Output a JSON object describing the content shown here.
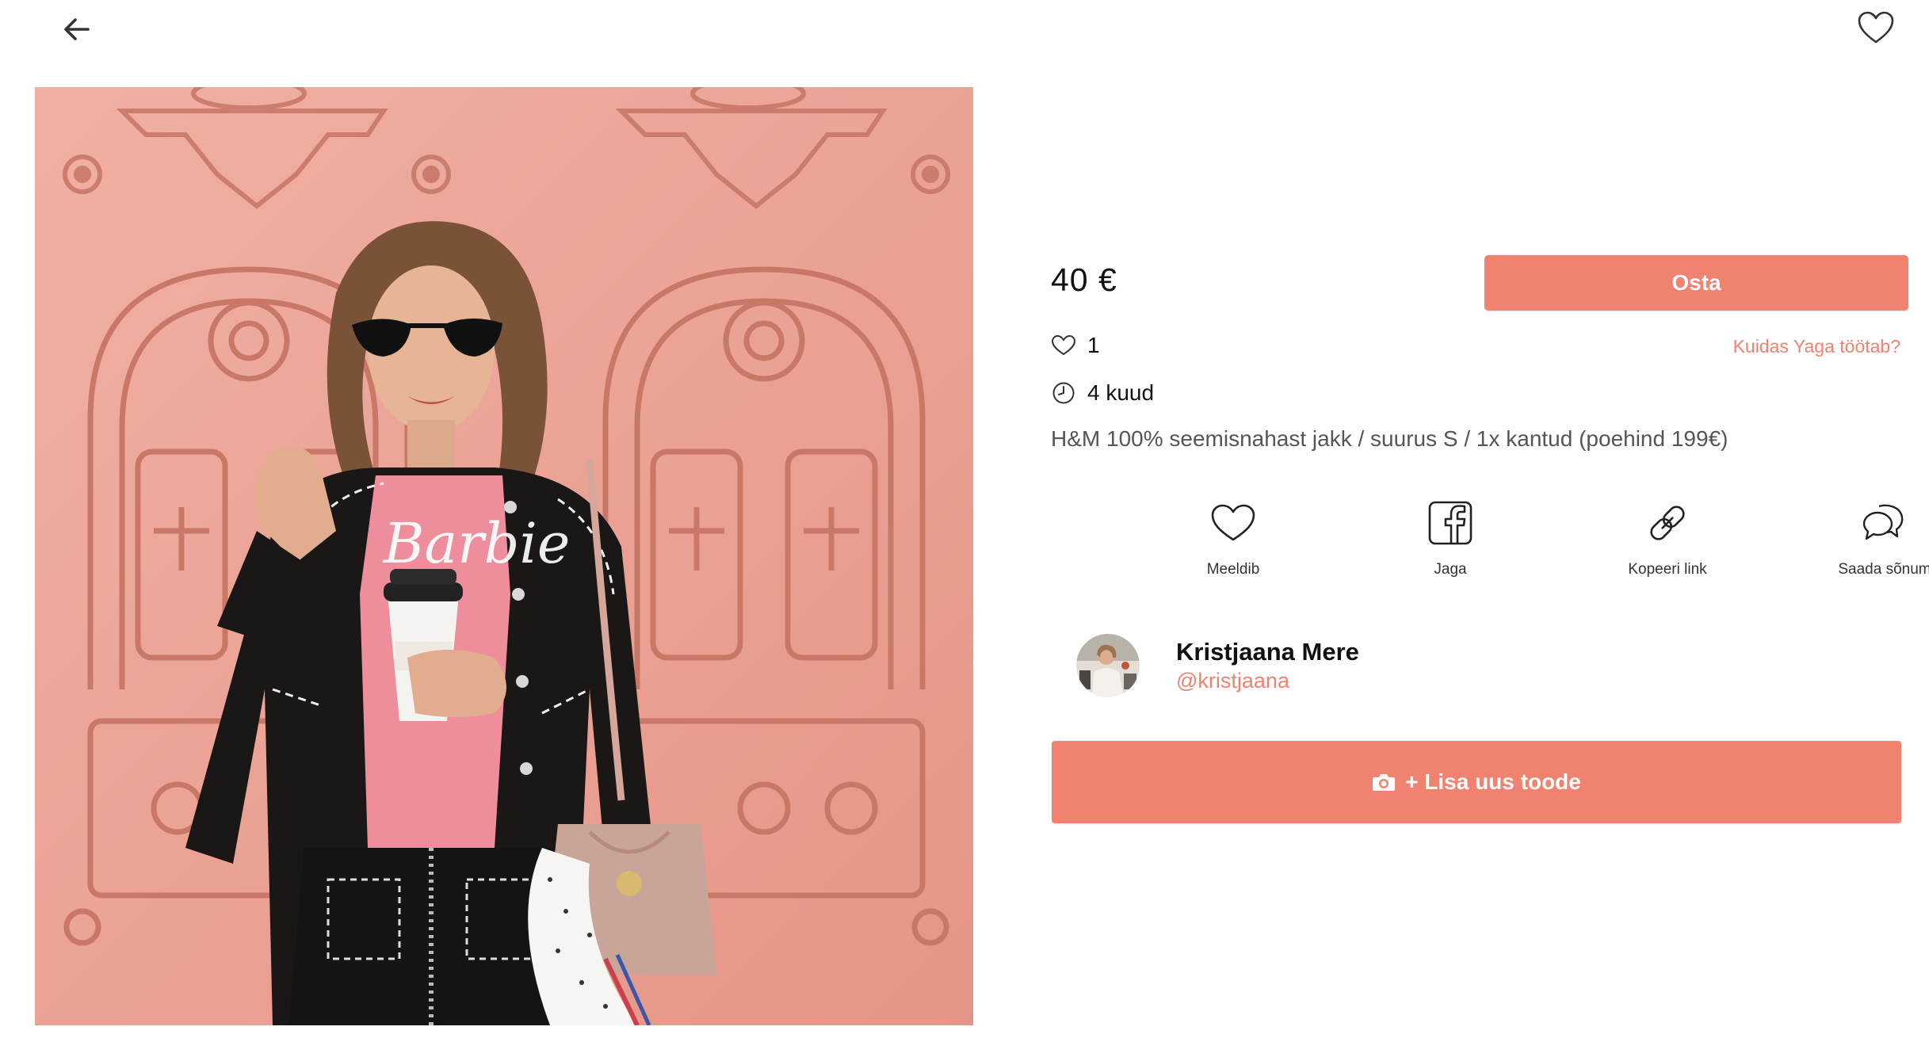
{
  "header": {
    "back_icon": "arrow-left-icon",
    "favorite_icon": "heart-outline-icon"
  },
  "product": {
    "price": "40 €",
    "buy_label": "Osta",
    "how_it_works": "Kuidas Yaga töötab?",
    "likes": "1",
    "age": "4 kuud",
    "description": "H&M 100% seemisnahast jakk / suurus S / 1x kantud (poehind 199€)"
  },
  "actions": [
    {
      "label": "Meeldib",
      "icon": "heart-icon"
    },
    {
      "label": "Jaga",
      "icon": "facebook-icon"
    },
    {
      "label": "Kopeeri link",
      "icon": "link-icon"
    },
    {
      "label": "Saada sõnum",
      "icon": "chat-bubbles-icon"
    }
  ],
  "seller": {
    "name": "Kristjaana Mere",
    "handle": "@kristjaana"
  },
  "add_product": {
    "label": "+ Lisa uus toode",
    "icon": "camera-icon"
  },
  "colors": {
    "accent": "#f0826f",
    "photo_background": "#e9a293"
  }
}
